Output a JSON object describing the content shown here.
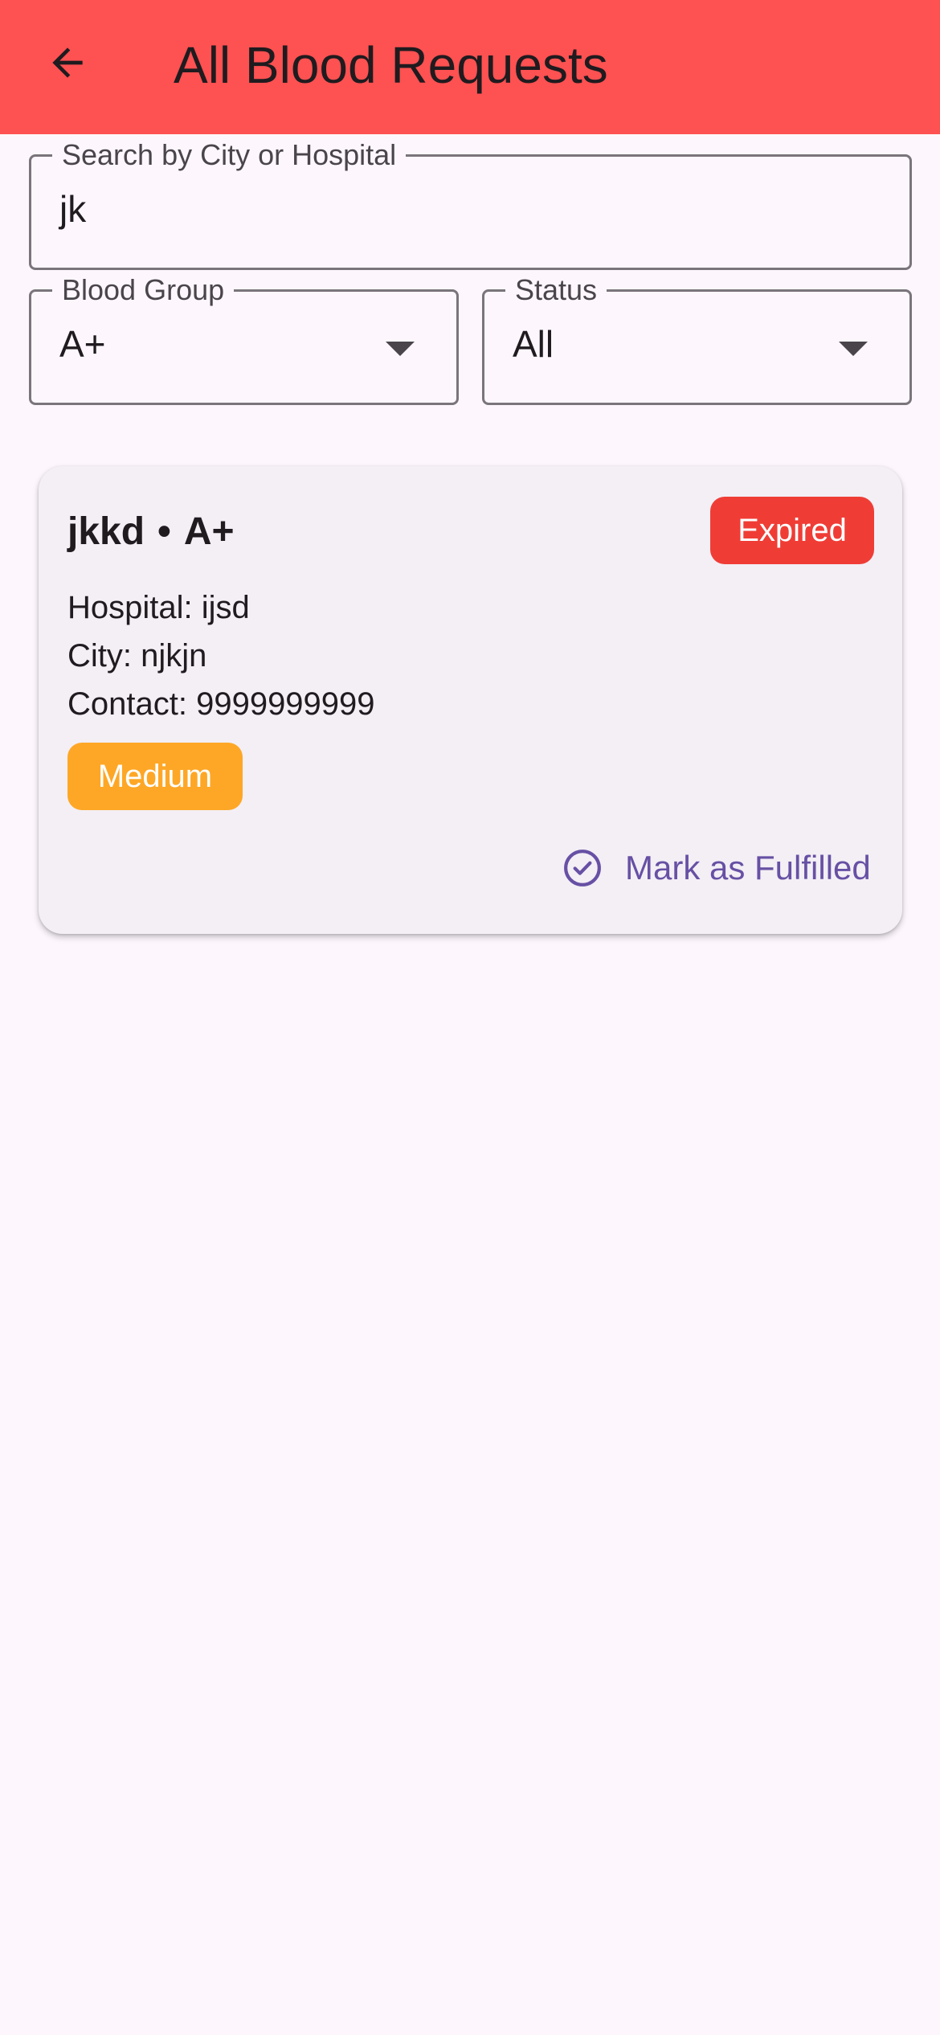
{
  "appbar": {
    "title": "All Blood Requests",
    "back_icon": "arrow-back-icon",
    "background": "#fe5151"
  },
  "filters": {
    "search": {
      "label": "Search by City or Hospital",
      "value": "jk"
    },
    "blood_group": {
      "label": "Blood Group",
      "value": "A+"
    },
    "status": {
      "label": "Status",
      "value": "All"
    }
  },
  "requests": [
    {
      "name": "jkkd",
      "separator": "•",
      "blood_group": "A+",
      "status_badge": "Expired",
      "hospital": "Hospital: ijsd",
      "city": "City: njkjn",
      "contact": "Contact: 9999999999",
      "priority": "Medium",
      "action_label": "Mark as Fulfilled",
      "action_icon": "check-circle-icon"
    }
  ],
  "colors": {
    "expired": "#ef3d36",
    "medium_priority": "#fea726",
    "action": "#6750a4"
  }
}
